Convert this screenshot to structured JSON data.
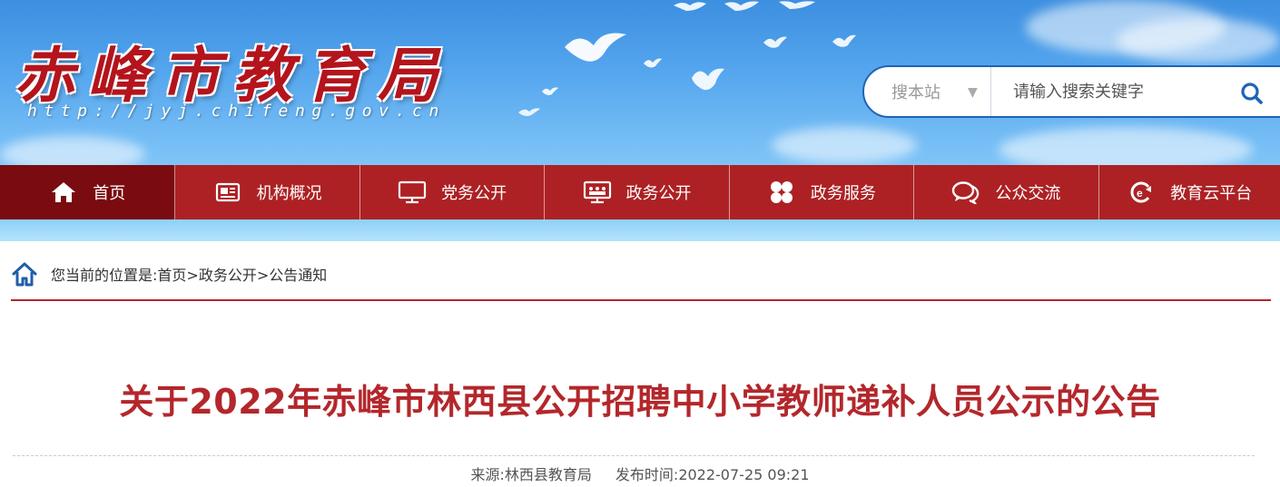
{
  "header": {
    "site_title": "赤峰市教育局",
    "site_url": "http://jyj.chifeng.gov.cn"
  },
  "search": {
    "scope_label": "搜本站",
    "placeholder": "请输入搜索关键字",
    "value": ""
  },
  "nav": {
    "items": [
      {
        "label": "首页",
        "icon": "home-icon"
      },
      {
        "label": "机构概况",
        "icon": "newspaper-icon"
      },
      {
        "label": "党务公开",
        "icon": "monitor-icon"
      },
      {
        "label": "政务公开",
        "icon": "presentation-icon"
      },
      {
        "label": "政务服务",
        "icon": "grid-icon"
      },
      {
        "label": "公众交流",
        "icon": "chat-icon"
      },
      {
        "label": "教育云平台",
        "icon": "cloud-icon"
      }
    ]
  },
  "breadcrumb": {
    "prefix": "您当前的位置是:",
    "items": [
      "首页",
      "政务公开",
      "公告通知"
    ],
    "separator": ">"
  },
  "article": {
    "title": "关于2022年赤峰市林西县公开招聘中小学教师递补人员公示的公告",
    "source_label": "来源:",
    "source": "林西县教育局",
    "date_label": "发布时间:",
    "date": "2022-07-25 09:21"
  },
  "colors": {
    "brand_red": "#ad2124",
    "nav_active": "#7a0b10",
    "title_red": "#b3272b",
    "search_border": "#1e64b4"
  }
}
